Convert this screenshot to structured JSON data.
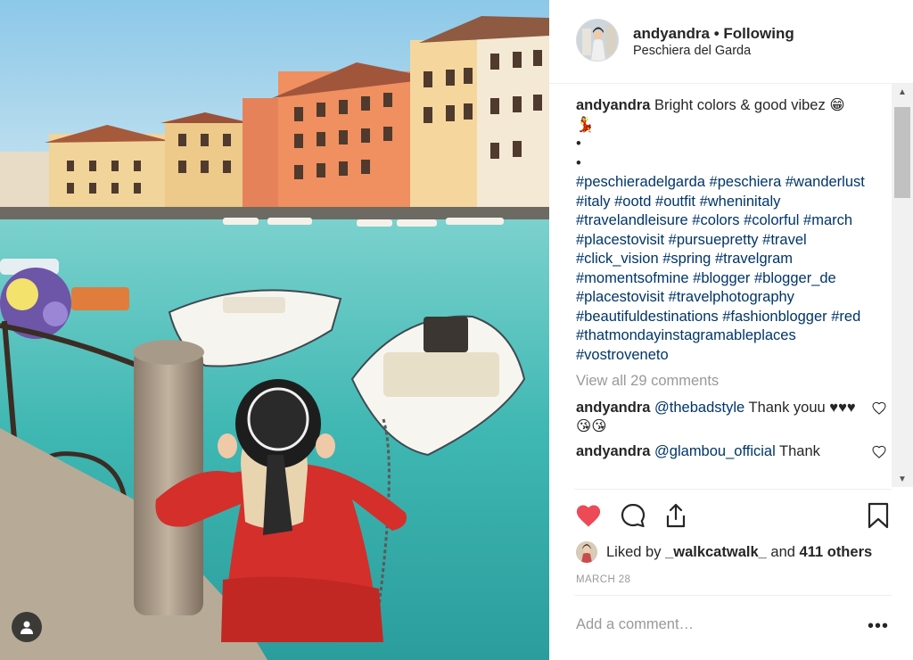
{
  "post": {
    "username": "andyandra",
    "follow_status": "Following",
    "separator": "•",
    "location": "Peschiera del Garda"
  },
  "caption": {
    "username": "andyandra",
    "text": "Bright colors & good vibez 😁\n💃\n•\n•",
    "hashtags": [
      "#peschieradelgarda",
      "#peschiera",
      "#wanderlust",
      "#italy",
      "#ootd",
      "#outfit",
      "#wheninitaly",
      "#travelandleisure",
      "#colors",
      "#colorful",
      "#march",
      "#placestovisit",
      "#pursuepretty",
      "#travel",
      "#click_vision",
      "#spring",
      "#travelgram",
      "#momentsofmine",
      "#blogger",
      "#blogger_de",
      "#placestovisit",
      "#travelphotography",
      "#beautifuldestinations",
      "#fashionblogger",
      "#red",
      "#thatmondayinstagramableplaces",
      "#vostroveneto"
    ]
  },
  "view_all_comments": "View all 29 comments",
  "comments": [
    {
      "username": "andyandra",
      "mention": "@thebadstyle",
      "text": " Thank youu ♥♥♥😘😘"
    },
    {
      "username": "andyandra",
      "mention": "@glambou_official",
      "text": " Thank"
    }
  ],
  "likes": {
    "prefix": "Liked by",
    "user": "_walkcatwalk_",
    "connector": "and",
    "others": "411 others"
  },
  "date": "MARCH 28",
  "add_comment_placeholder": "Add a comment…",
  "more_label": "•••",
  "icons": {
    "like": "heart-icon",
    "comment": "speech-bubble-icon",
    "share": "share-icon",
    "save": "bookmark-icon",
    "tagged": "user-tag-icon"
  },
  "colors": {
    "liked_heart": "#ed4956",
    "link_blue": "#003569",
    "muted_text": "#999999"
  }
}
